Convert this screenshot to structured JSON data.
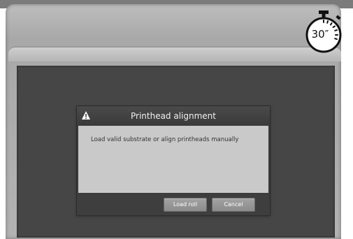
{
  "dialog": {
    "title": "Printhead alignment",
    "message": "Load valid substrate or align printheads manually",
    "buttons": {
      "load_roll": "Load roll",
      "cancel": "Cancel"
    }
  },
  "timer": {
    "label": "30″"
  },
  "icons": {
    "dialog_icon": "warning-icon",
    "timer_icon": "stopwatch-icon"
  },
  "colors": {
    "screen": "#464646",
    "dialog_body": "#c9c9c9",
    "button": "#999999"
  }
}
